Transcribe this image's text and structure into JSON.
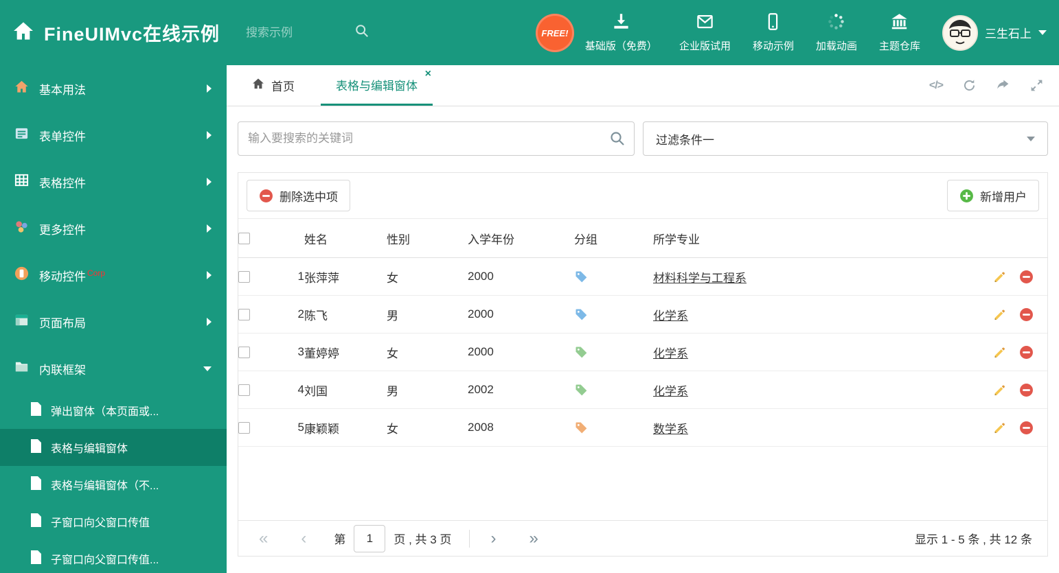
{
  "header": {
    "title": "FineUIMvc在线示例",
    "search_placeholder": "搜索示例",
    "free_badge": "FREE!",
    "nav_items": [
      {
        "label": "基础版（免费）",
        "icon": "download-icon"
      },
      {
        "label": "企业版试用",
        "icon": "envelope-icon"
      },
      {
        "label": "移动示例",
        "icon": "mobile-icon"
      },
      {
        "label": "加载动画",
        "icon": "spinner-icon"
      },
      {
        "label": "主题仓库",
        "icon": "bank-icon"
      }
    ],
    "user_name": "三生石上"
  },
  "sidebar": {
    "items": [
      {
        "label": "基本用法"
      },
      {
        "label": "表单控件"
      },
      {
        "label": "表格控件"
      },
      {
        "label": "更多控件"
      },
      {
        "label": "移动控件",
        "badge": "Corp"
      },
      {
        "label": "页面布局"
      },
      {
        "label": "内联框架"
      }
    ],
    "subitems": [
      {
        "label": "弹出窗体（本页面或..."
      },
      {
        "label": "表格与编辑窗体"
      },
      {
        "label": "表格与编辑窗体（不..."
      },
      {
        "label": "子窗口向父窗口传值"
      },
      {
        "label": "子窗口向父窗口传值..."
      }
    ]
  },
  "tabs": [
    {
      "label": "首页"
    },
    {
      "label": "表格与编辑窗体",
      "active": true
    }
  ],
  "filter": {
    "search_placeholder": "输入要搜索的关键词",
    "dropdown_value": "过滤条件一"
  },
  "toolbar": {
    "delete_label": "删除选中项",
    "add_label": "新增用户"
  },
  "table": {
    "headers": {
      "name": "姓名",
      "gender": "性别",
      "year": "入学年份",
      "group": "分组",
      "major": "所学专业"
    },
    "rows": [
      {
        "num": "1",
        "name": "张萍萍",
        "gender": "女",
        "year": "2000",
        "tag_color": "#6fb1e4",
        "major": "材料科学与工程系"
      },
      {
        "num": "2",
        "name": "陈飞",
        "gender": "男",
        "year": "2000",
        "tag_color": "#6fb1e4",
        "major": "化学系"
      },
      {
        "num": "3",
        "name": "董婷婷",
        "gender": "女",
        "year": "2000",
        "tag_color": "#87c785",
        "major": "化学系"
      },
      {
        "num": "4",
        "name": "刘国",
        "gender": "男",
        "year": "2002",
        "tag_color": "#87c785",
        "major": "化学系"
      },
      {
        "num": "5",
        "name": "康颖颖",
        "gender": "女",
        "year": "2008",
        "tag_color": "#f0a566",
        "major": "数学系"
      }
    ]
  },
  "pagination": {
    "page_prefix": "第",
    "page_value": "1",
    "page_suffix": "页 , 共 3 页",
    "summary": "显示 1 - 5 条 , 共 12 条"
  },
  "colors": {
    "accent": "#19997f",
    "sidebar_active": "#0e7f68",
    "tab_active": "#17917a",
    "free_badge": "#f96231",
    "delete_red": "#e2574c",
    "add_green": "#57b947",
    "pencil_yellow": "#f6c64f"
  }
}
